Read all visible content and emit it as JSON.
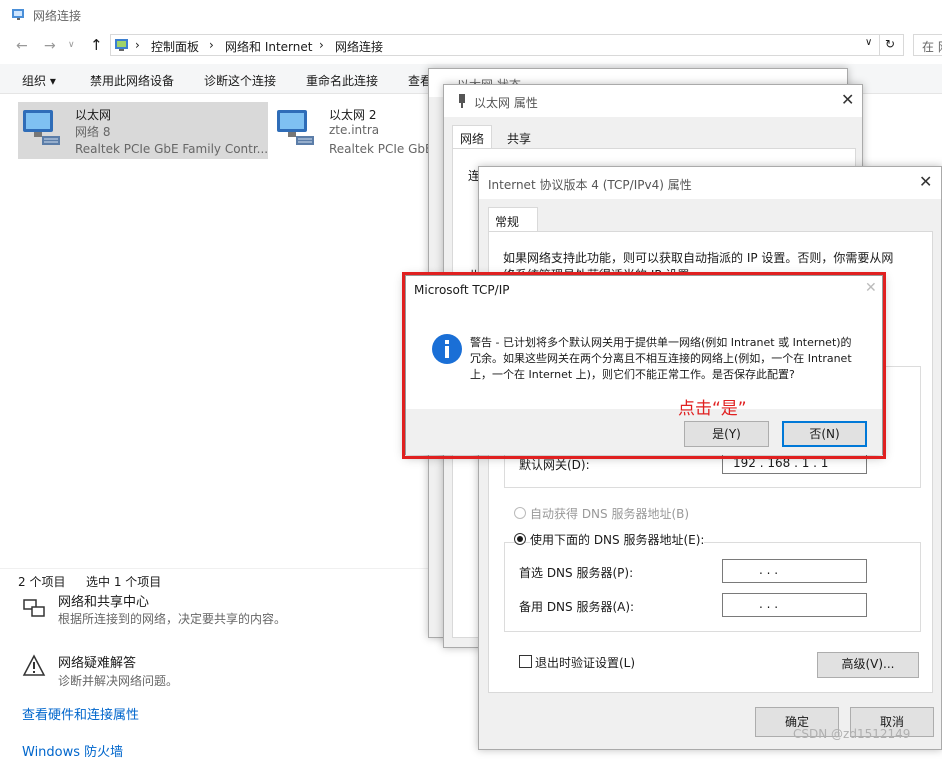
{
  "explorer": {
    "title": "网络连接",
    "breadcrumb": [
      "控制面板",
      "网络和 Internet",
      "网络连接"
    ],
    "search_placeholder": "在 网",
    "toolbar": [
      "组织 ▾",
      "禁用此网络设备",
      "诊断这个连接",
      "重命名此连接",
      "查看"
    ],
    "adapters": [
      {
        "name": "以太网",
        "network": "网络 8",
        "device": "Realtek PCIe GbE Family Contr..."
      },
      {
        "name": "以太网 2",
        "network": "zte.intra",
        "device": "Realtek PCIe GbE"
      }
    ],
    "status": {
      "count": "2 个项目",
      "selected": "选中 1 个项目"
    }
  },
  "bg_sidebar": {
    "sharing_title": "网络和共享中心",
    "sharing_desc": "根据所连接到的网络，决定要共享的内容。",
    "trouble_title": "网络疑难解答",
    "trouble_desc": "诊断并解决网络问题。",
    "hw_link": "查看硬件和连接属性",
    "firewall_link": "Windows 防火墙"
  },
  "status_dialog": {
    "title": "以太网 状态"
  },
  "props_dialog": {
    "title": "以太网 属性",
    "tabs": [
      "网络",
      "共享"
    ],
    "frag1": "连",
    "frag2": "此"
  },
  "ipv4_dialog": {
    "title": "Internet 协议版本 4 (TCP/IPv4) 属性",
    "tab": "常规",
    "intro_line1": "如果网络支持此功能，则可以获取自动指派的 IP 设置。否则，你需要从网",
    "intro_line2": "络系统管理员处获得适当的 IP 设置。",
    "gateway_label": "默认网关(D):",
    "gateway_value": "192 . 168 .  1  .  1",
    "dns_auto": "自动获得 DNS 服务器地址(B)",
    "dns_manual": "使用下面的 DNS 服务器地址(E):",
    "dns_primary_label": "首选 DNS 服务器(P):",
    "dns_secondary_label": "备用 DNS 服务器(A):",
    "dns_empty": ".       .       .",
    "validate": "退出时验证设置(L)",
    "advanced": "高级(V)...",
    "ok": "确定",
    "cancel": "取消"
  },
  "alert": {
    "title": "Microsoft TCP/IP",
    "message_line1": "警告 - 已计划将多个默认网关用于提供单一网络(例如 Intranet 或 Internet)的",
    "message_line2": "冗余。如果这些网关在两个分离且不相互连接的网络上(例如，一个在 Intranet",
    "message_line3": "上，一个在 Internet 上)，则它们不能正常工作。是否保存此配置?",
    "yes": "是(Y)",
    "no": "否(N)"
  },
  "annotation": {
    "text": "点击“是”",
    "color": "#e02020"
  },
  "watermark": "CSDN @zd1512149",
  "colors": {
    "highlight_border": "#e02020",
    "info_icon": "#1a6fd6",
    "link": "#0066cc"
  }
}
